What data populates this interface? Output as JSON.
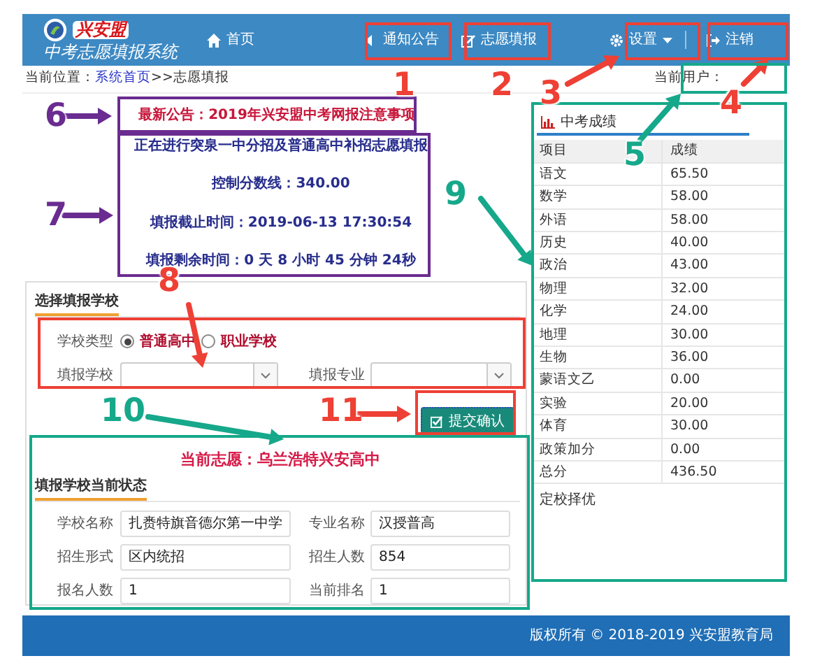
{
  "header": {
    "logo_text": "兴安盟",
    "system_name": "中考志愿填报系统",
    "nav": [
      {
        "label": "首页",
        "dropdown": false
      },
      {
        "label": "通知公告",
        "dropdown": false
      },
      {
        "label": "志愿填报",
        "dropdown": false
      },
      {
        "label": "设置",
        "dropdown": true
      },
      {
        "label": "注销",
        "dropdown": false
      }
    ]
  },
  "breadcrumb": {
    "label": "当前位置：",
    "link": "系统首页",
    "trail": ">>志愿填报",
    "user_label": "当前用户："
  },
  "notice": "最新公告：2019年兴安盟中考网报注意事项",
  "countdown": [
    "正在进行突泉一中分招及普通高中补招志愿填报",
    "控制分数线：340.00",
    "填报截止时间：2019-06-13 17:30:54",
    "填报剩余时间：0 天 8 小时 45 分钟 24秒"
  ],
  "school_form": {
    "heading": "选择填报学校",
    "type_label": "学校类型",
    "options": [
      {
        "label": "普通高中",
        "selected": true
      },
      {
        "label": "职业学校",
        "selected": false
      }
    ],
    "school_label": "填报学校",
    "major_label": "填报专业",
    "submit": "提交确认"
  },
  "current_choice": "当前志愿：乌兰浩特兴安高中",
  "status": {
    "heading": "填报学校当前状态",
    "fields": [
      {
        "label": "学校名称",
        "value": "扎赉特旗音德尔第一中学"
      },
      {
        "label": "专业名称",
        "value": "汉授普高"
      },
      {
        "label": "招生形式",
        "value": "区内统招"
      },
      {
        "label": "招生人数",
        "value": "854"
      },
      {
        "label": "报名人数",
        "value": "1"
      },
      {
        "label": "当前排名",
        "value": "1"
      }
    ]
  },
  "scores": {
    "tab": "中考成绩",
    "columns": [
      "项目",
      "成绩"
    ],
    "rows": [
      [
        "语文",
        "65.50"
      ],
      [
        "数学",
        "58.00"
      ],
      [
        "外语",
        "58.00"
      ],
      [
        "历史",
        "40.00"
      ],
      [
        "政治",
        "43.00"
      ],
      [
        "物理",
        "32.00"
      ],
      [
        "化学",
        "24.00"
      ],
      [
        "地理",
        "30.00"
      ],
      [
        "生物",
        "36.00"
      ],
      [
        "蒙语文乙",
        "0.00"
      ],
      [
        "实验",
        "20.00"
      ],
      [
        "体育",
        "30.00"
      ],
      [
        "政策加分",
        "0.00"
      ],
      [
        "总分",
        "436.50"
      ]
    ],
    "note": "定校择优"
  },
  "footer": "版权所有 © 2018-2019 兴安盟教育局",
  "annotations": [
    {
      "label": "1",
      "color": "#ee4035"
    },
    {
      "label": "2",
      "color": "#ee4035"
    },
    {
      "label": "3",
      "color": "#ee4035"
    },
    {
      "label": "4",
      "color": "#ee4035"
    },
    {
      "label": "5",
      "color": "#16a88a"
    },
    {
      "label": "6",
      "color": "#6a2c90"
    },
    {
      "label": "7",
      "color": "#6a2c90"
    },
    {
      "label": "8",
      "color": "#ee4035"
    },
    {
      "label": "9",
      "color": "#16a88a"
    },
    {
      "label": "10",
      "color": "#16a88a"
    },
    {
      "label": "11",
      "color": "#ee4035"
    }
  ]
}
